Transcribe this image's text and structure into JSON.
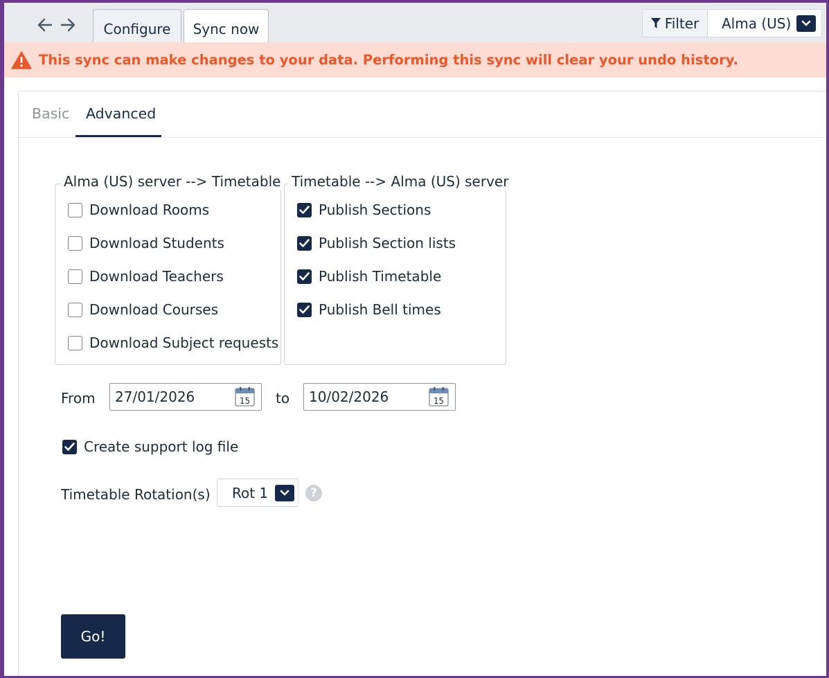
{
  "header": {
    "back_icon": "arrow-left-icon",
    "forward_icon": "arrow-right-icon",
    "tabs": [
      {
        "label": "Configure",
        "active": false
      },
      {
        "label": "Sync now",
        "active": true
      }
    ],
    "filter_label": "Filter",
    "filter_icon": "funnel-icon",
    "server_select_value": "Alma (US)"
  },
  "warning": {
    "icon": "warning-triangle-icon",
    "text": "This sync can make changes to your data. Performing this sync will clear your undo history.",
    "color": "#e8582a",
    "background": "#fddcd3"
  },
  "subtabs": [
    {
      "label": "Basic",
      "active": false
    },
    {
      "label": "Advanced",
      "active": true
    }
  ],
  "download_group": {
    "legend": "Alma (US) server --> Timetable",
    "items": [
      {
        "label": "Download Rooms",
        "checked": false
      },
      {
        "label": "Download Students",
        "checked": false
      },
      {
        "label": "Download Teachers",
        "checked": false
      },
      {
        "label": "Download Courses",
        "checked": false
      },
      {
        "label": "Download Subject requests",
        "checked": false
      }
    ]
  },
  "publish_group": {
    "legend": "Timetable --> Alma (US) server",
    "items": [
      {
        "label": "Publish Sections",
        "checked": true
      },
      {
        "label": "Publish Section lists",
        "checked": true
      },
      {
        "label": "Publish Timetable",
        "checked": true
      },
      {
        "label": "Publish Bell times",
        "checked": true
      }
    ]
  },
  "date_range": {
    "from_label": "From",
    "from_value": "27/01/2026",
    "to_label": "to",
    "to_value": "10/02/2026",
    "calendar_day": "15"
  },
  "support_log": {
    "label": "Create support log file",
    "checked": true
  },
  "rotation": {
    "label": "Timetable Rotation(s)",
    "value": "Rot 1",
    "help": "?"
  },
  "go_button": "Go!",
  "colors": {
    "accent": "#16294a",
    "frame": "#6a3a8e"
  }
}
